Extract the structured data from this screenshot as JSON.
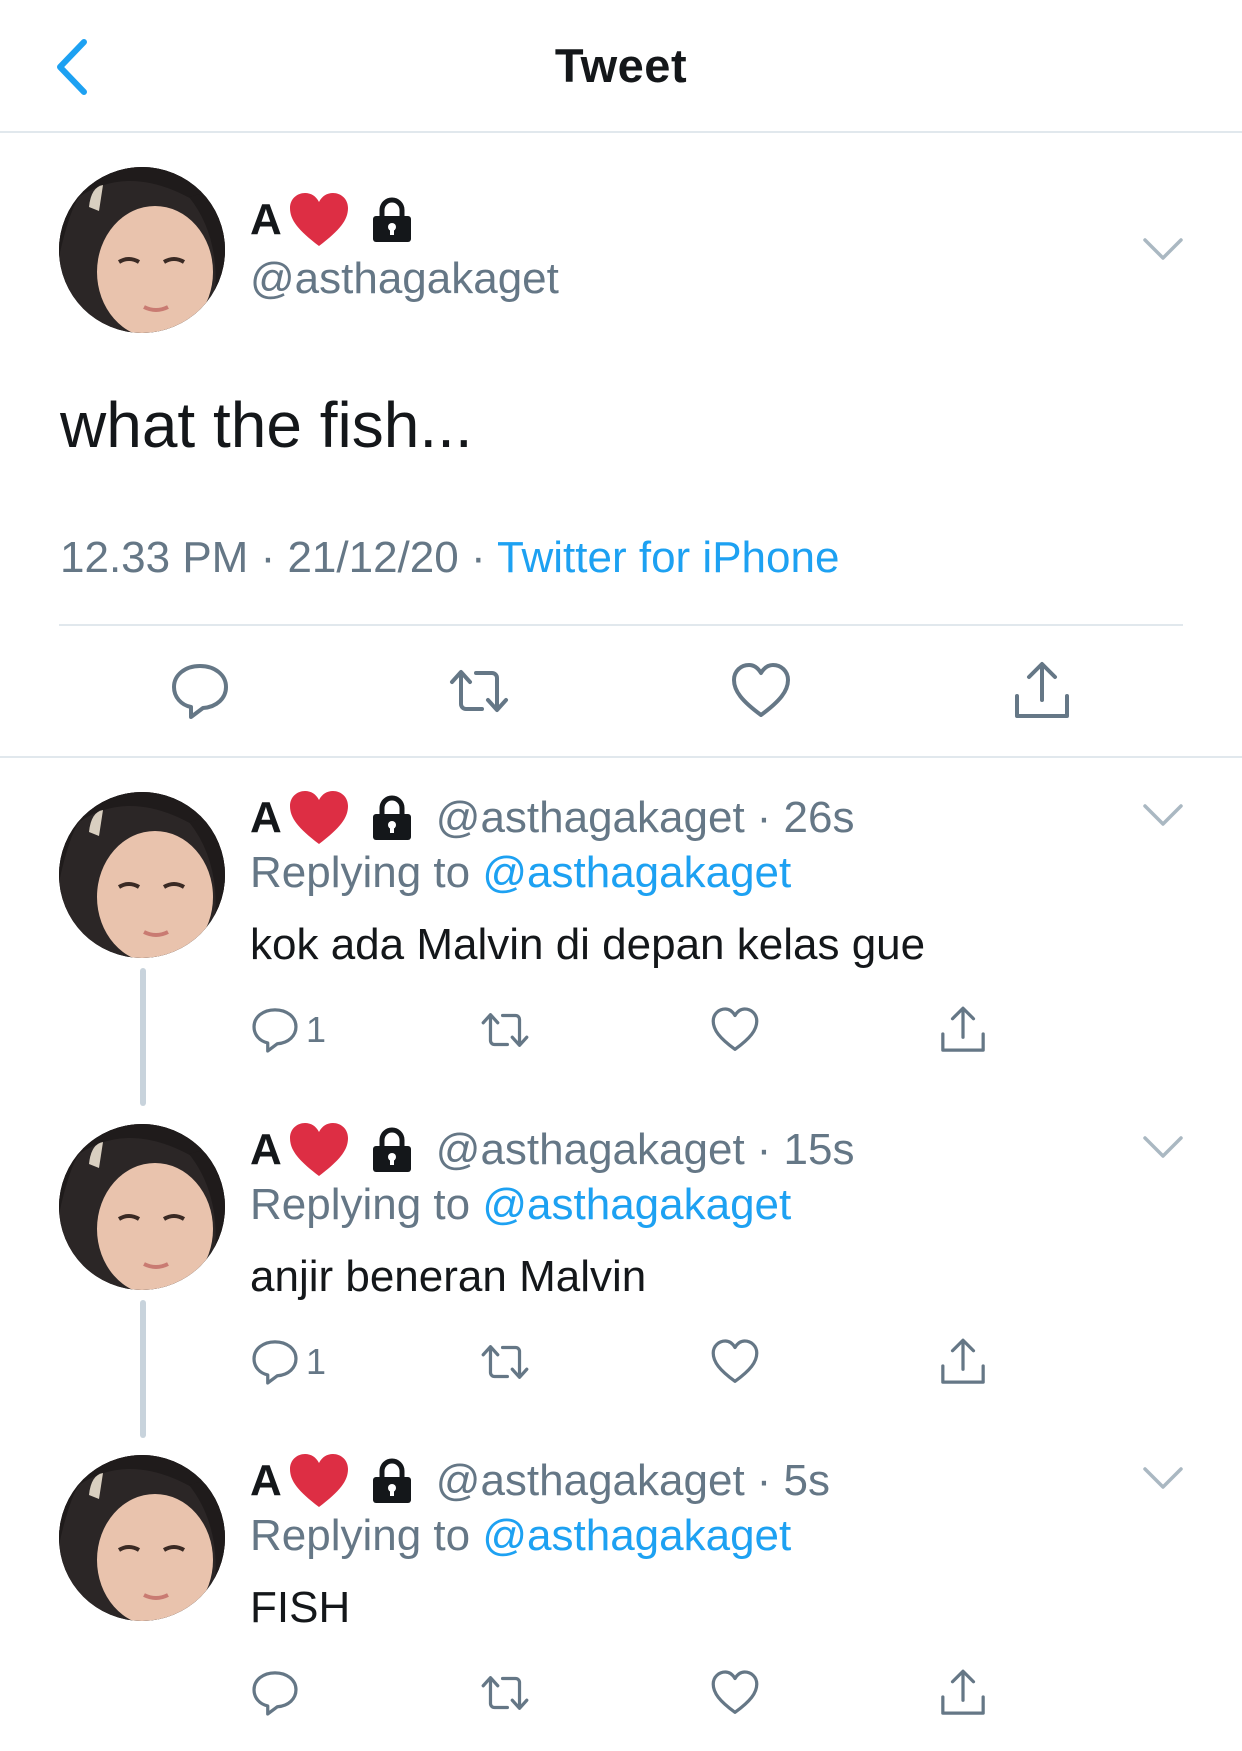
{
  "header": {
    "title": "Tweet",
    "back_icon": "chevron-left-icon"
  },
  "colors": {
    "accent": "#1da1f2",
    "secondary_text": "#657786",
    "divider": "#e1e8ed",
    "heart": "#dd2e44"
  },
  "main_tweet": {
    "name": "A",
    "handle": "@asthagakaget",
    "text": "what the fish...",
    "time": "12.33 PM",
    "separator": " · ",
    "date": "21/12/20",
    "source": "Twitter for iPhone",
    "badge_icons": [
      "red-heart-emoji",
      "lock-icon"
    ],
    "action_icons": [
      "reply-icon",
      "retweet-icon",
      "like-icon",
      "share-icon"
    ]
  },
  "replies": [
    {
      "name": "A",
      "handle": "@asthagakaget",
      "time": "· 26s",
      "replying_label": "Replying to ",
      "replying_to": "@asthagakaget",
      "text": "kok ada Malvin di depan kelas gue",
      "reply_count": "1"
    },
    {
      "name": "A",
      "handle": "@asthagakaget",
      "time": "· 15s",
      "replying_label": "Replying to ",
      "replying_to": "@asthagakaget",
      "text": "anjir beneran Malvin",
      "reply_count": "1"
    },
    {
      "name": "A",
      "handle": "@asthagakaget",
      "time": "· 5s",
      "replying_label": "Replying to ",
      "replying_to": "@asthagakaget",
      "text": "FISH",
      "reply_count": ""
    }
  ]
}
